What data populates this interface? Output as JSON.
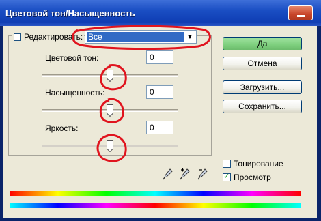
{
  "window": {
    "title": "Цветовой тон/Насыщенность"
  },
  "edit": {
    "label": "Редактировать:",
    "value": "Все"
  },
  "sliders": [
    {
      "label": "Цветовой тон:",
      "value": "0",
      "level": 0.5
    },
    {
      "label": "Насыщенность:",
      "value": "0",
      "level": 0.5
    },
    {
      "label": "Яркость:",
      "value": "0",
      "level": 0.5
    }
  ],
  "buttons": {
    "ok": "Да",
    "cancel": "Отмена",
    "load": "Загрузить...",
    "save": "Сохранить..."
  },
  "options": {
    "colorize_label": "Тонирование",
    "colorize_checked": false,
    "preview_label": "Просмотр",
    "preview_checked": true
  },
  "colors": {
    "titlebar": "#1a4ec3",
    "dialog_bg": "#ece9d8",
    "selection": "#316ac5",
    "annotation": "#e0141e",
    "ok_button": "#7ecf7e"
  },
  "icons": [
    "close-icon",
    "dropdown-arrow-icon",
    "eyedropper-icon",
    "eyedropper-plus-icon",
    "eyedropper-minus-icon"
  ]
}
